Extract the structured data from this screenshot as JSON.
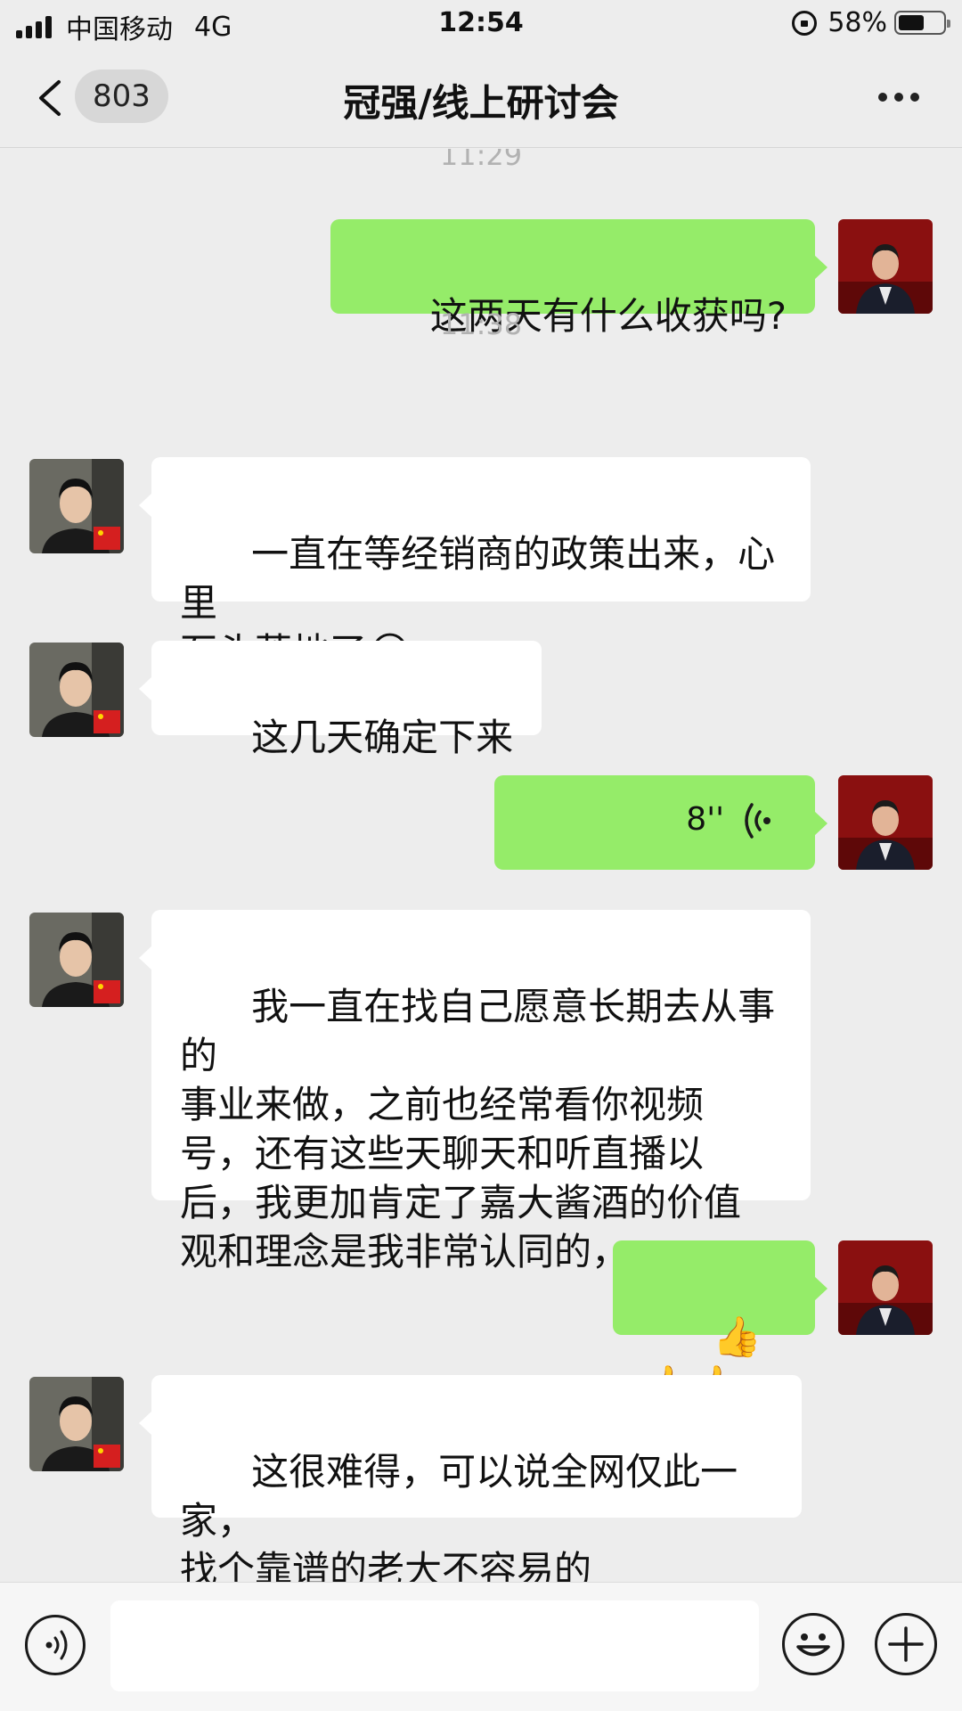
{
  "status_bar": {
    "carrier": "中国移动",
    "network": "4G",
    "time": "12:54",
    "battery": "58%",
    "battery_level": 0.58
  },
  "nav": {
    "unread_count": "803",
    "title": "冠强/线上研讨会"
  },
  "chat": {
    "timestamps": [
      "11:29",
      "11:38"
    ],
    "messages": [
      {
        "side": "out",
        "type": "text",
        "text": "这两天有什么收获吗?"
      },
      {
        "side": "in",
        "type": "text",
        "text": "一直在等经销商的政策出来，心里\n石头落地了",
        "emoji": "😂"
      },
      {
        "side": "in",
        "type": "text",
        "text": "这几天确定下来"
      },
      {
        "side": "out",
        "type": "voice",
        "duration": "8''"
      },
      {
        "side": "in",
        "type": "text",
        "text": "我一直在找自己愿意长期去从事的\n事业来做，之前也经常看你视频\n号，还有这些天聊天和听直播以\n后，我更加肯定了嘉大酱酒的价值\n观和理念是我非常认同的，"
      },
      {
        "side": "out",
        "type": "emoji",
        "text": "👍👍👍"
      },
      {
        "side": "in",
        "type": "text",
        "text": "这很难得，可以说全网仅此一家，\n找个靠谱的老大不容易的"
      }
    ]
  },
  "colors": {
    "background": "#ededed",
    "outgoing_bubble": "#95ec69",
    "incoming_bubble": "#ffffff",
    "timestamp": "#b2b2b2"
  },
  "icons": {
    "back": "chevron-left-icon",
    "more": "more-dots-icon",
    "voice_mode": "voice-mode-icon",
    "emoji": "smiley-icon",
    "plus": "plus-icon",
    "voice_message": "voice-wave-icon"
  }
}
